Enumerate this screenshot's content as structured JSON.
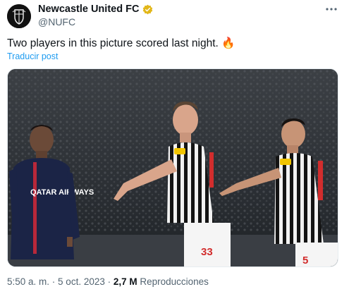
{
  "header": {
    "display_name": "Newcastle United FC",
    "handle": "@NUFC",
    "avatar_icon": "newcastle-crest-icon",
    "verified_icon": "gold-verified-badge-icon",
    "more_icon": "more-dots-icon"
  },
  "tweet": {
    "text": "Two players in this picture scored last night. 🔥",
    "translate_label": "Traducir post"
  },
  "photo": {
    "description_icon": "football-players-photo",
    "shirt_numbers": {
      "left_player": "33",
      "right_player": "5"
    },
    "sponsor_text": "QATAR AIRWAYS"
  },
  "meta": {
    "time": "5:50 a. m.",
    "separator1": " · ",
    "date": "5 oct. 2023",
    "separator2": " · ",
    "views_count": "2,7 M",
    "views_label": " Reproducciones"
  },
  "colors": {
    "link_blue": "#1d9bf0",
    "muted_text": "#536471",
    "verified_gold": "#e2b719"
  }
}
